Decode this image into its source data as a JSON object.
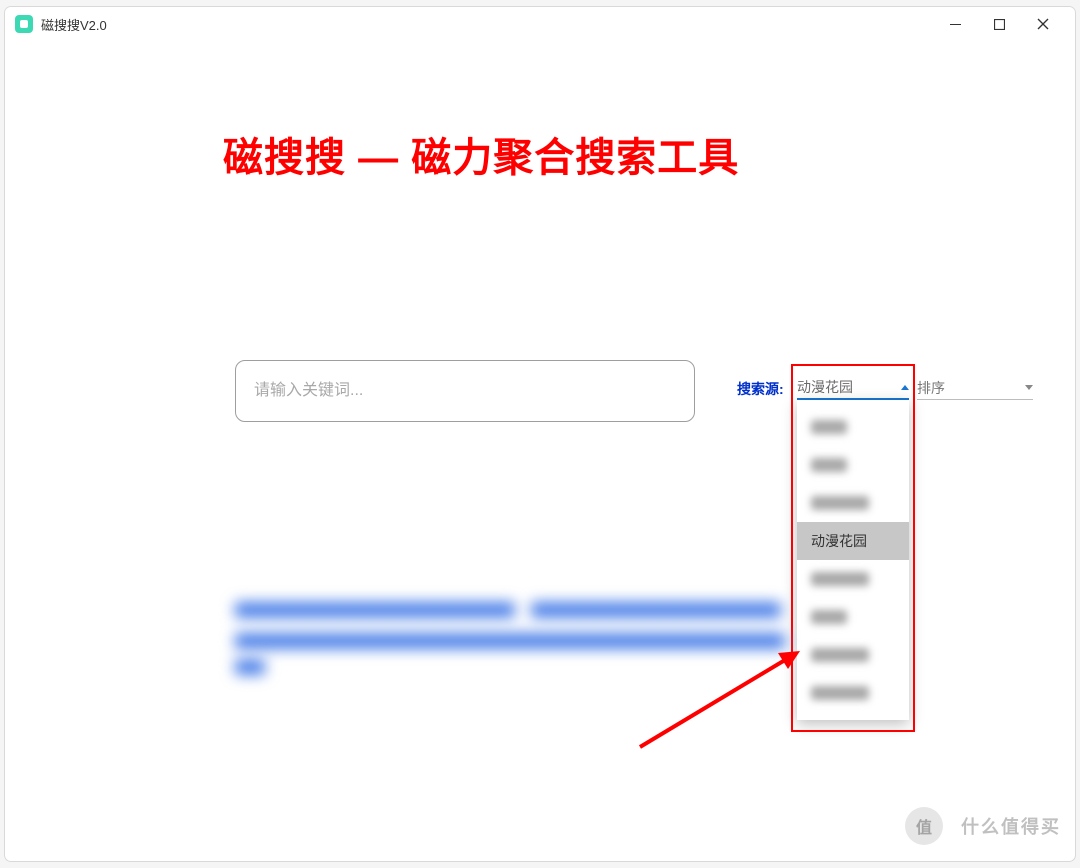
{
  "window": {
    "title": "磁搜搜V2.0"
  },
  "headline": "磁搜搜 — 磁力聚合搜索工具",
  "search": {
    "placeholder": "请输入关键词..."
  },
  "filters": {
    "source_label": "搜索源:",
    "source_selected": "动漫花园",
    "sort_label": "排序"
  },
  "dropdown": {
    "items": [
      {
        "label": "",
        "blurred": true,
        "w": "w30"
      },
      {
        "label": "",
        "blurred": true,
        "w": "w30"
      },
      {
        "label": "",
        "blurred": true,
        "w": "w60"
      },
      {
        "label": "动漫花园",
        "blurred": false,
        "selected": true
      },
      {
        "label": "",
        "blurred": true,
        "w": "w60"
      },
      {
        "label": "",
        "blurred": true,
        "w": "w30"
      },
      {
        "label": "",
        "blurred": true,
        "w": "w60"
      },
      {
        "label": "",
        "blurred": true,
        "w": "w60"
      }
    ]
  },
  "watermark": {
    "badge": "值",
    "text": "什么值得买"
  }
}
